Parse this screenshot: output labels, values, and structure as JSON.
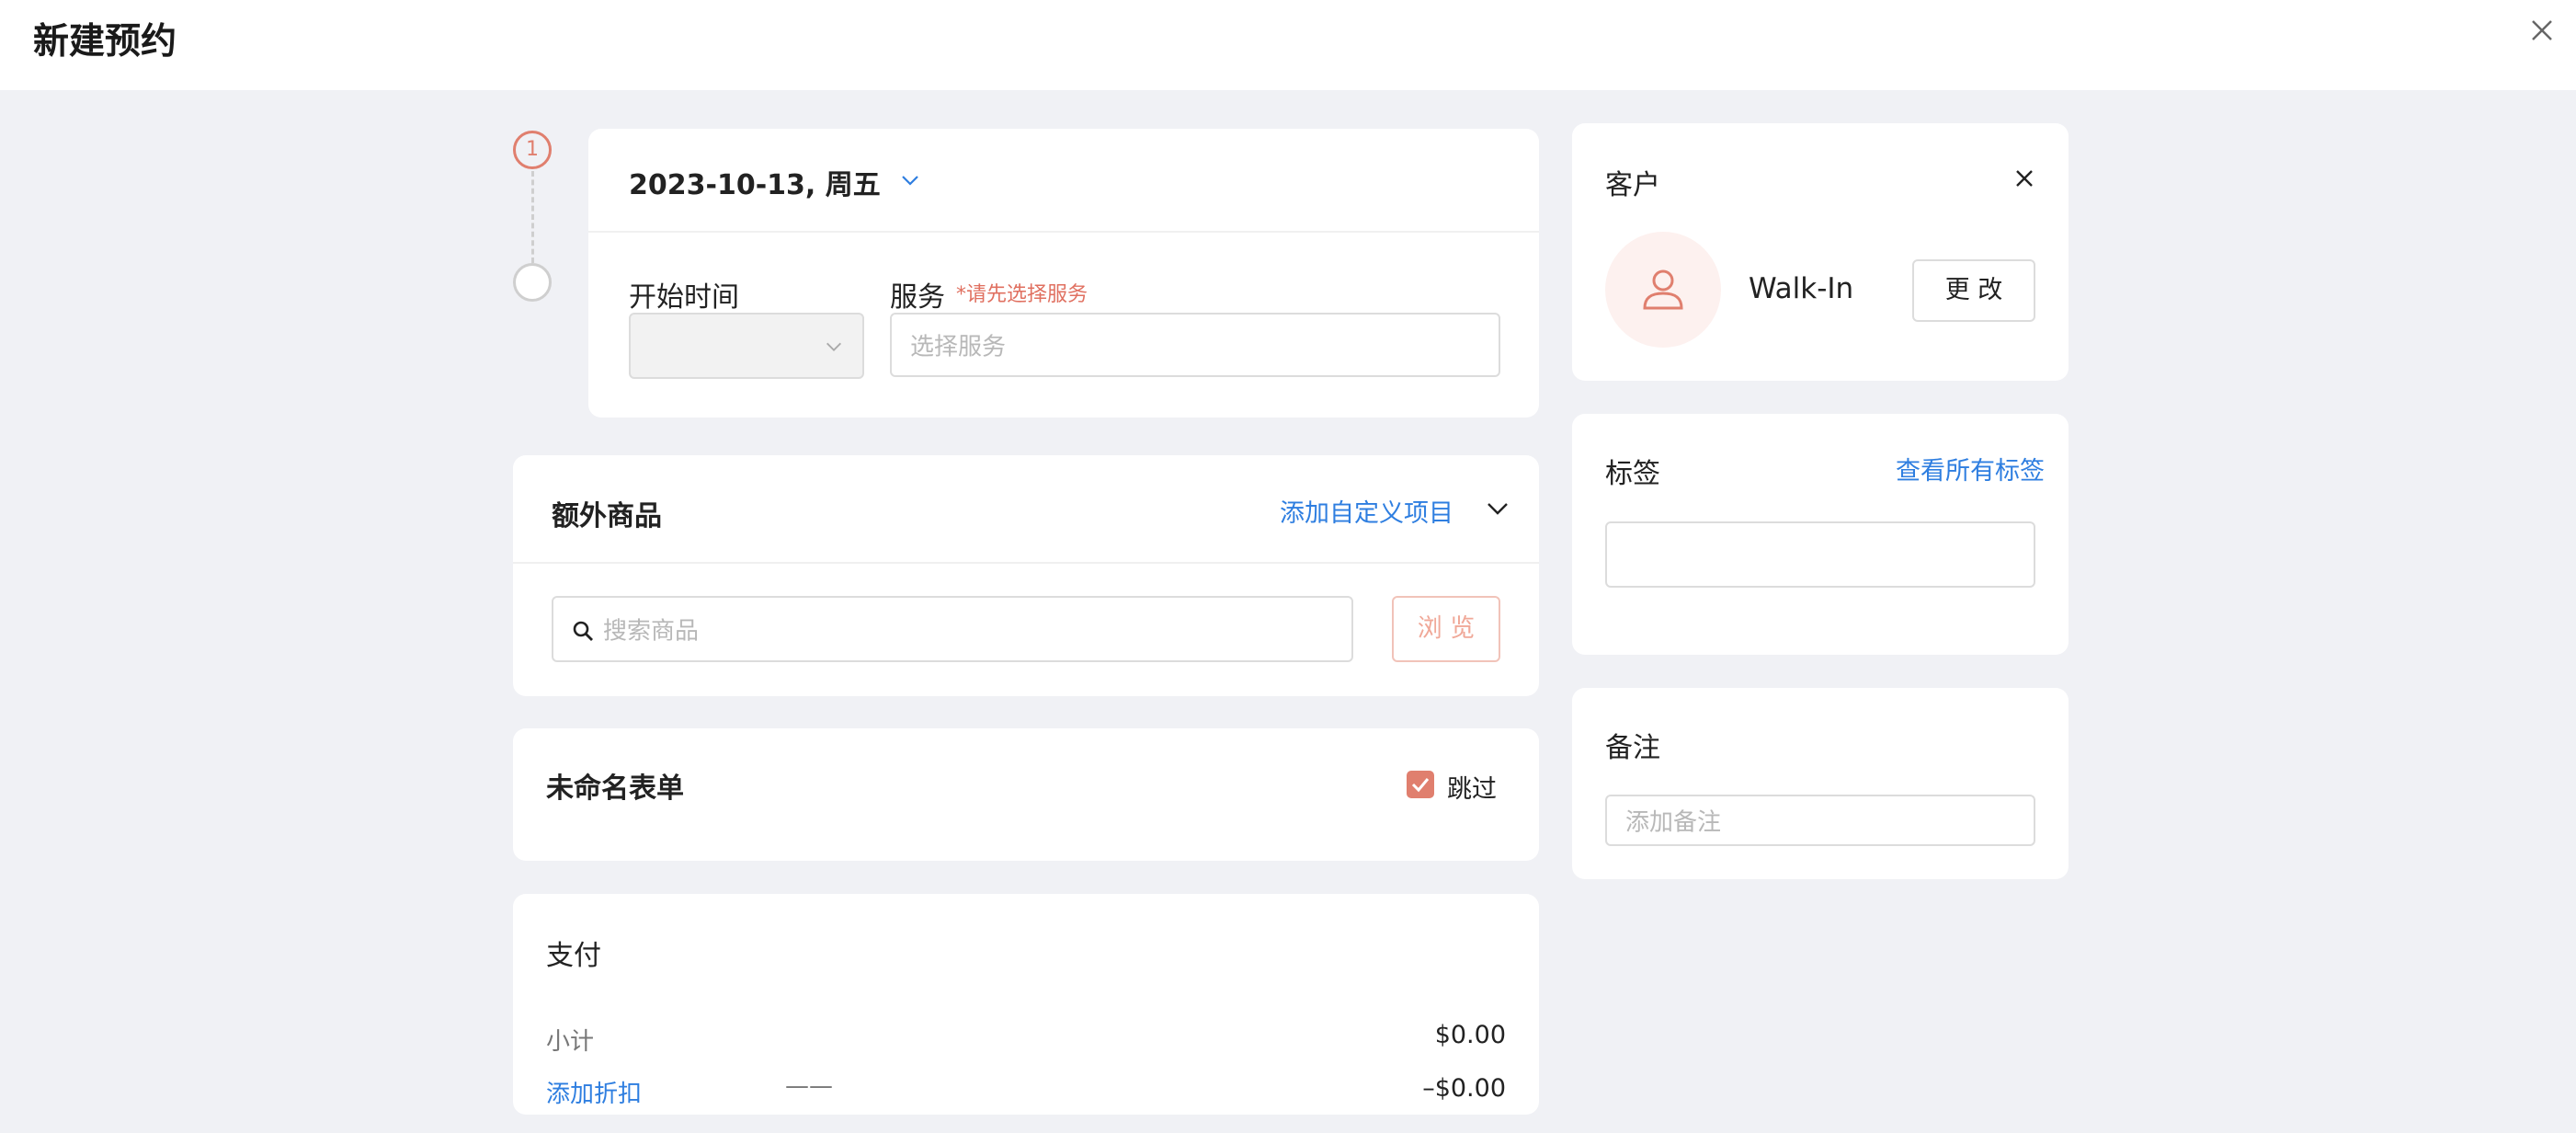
{
  "header": {
    "title": "新建预约"
  },
  "icons": {
    "close": "close-icon",
    "chevron": "chevron-down-icon",
    "search": "search-icon",
    "user": "user-icon",
    "check": "check-icon"
  },
  "colors": {
    "accent": "#e07f6e",
    "link": "#2e7ee0",
    "background": "#f0f1f5"
  },
  "steps": {
    "current": "1"
  },
  "appointment": {
    "date": "2023-10-13, 周五",
    "start_time_label": "开始时间",
    "start_time_value": "",
    "service_label": "服务",
    "service_required_hint": "*请先选择服务",
    "service_placeholder": "选择服务"
  },
  "extras": {
    "title": "额外商品",
    "add_custom_link": "添加自定义项目",
    "search_placeholder": "搜索商品",
    "browse_button": "浏 览"
  },
  "form": {
    "title": "未命名表单",
    "skip_label": "跳过",
    "skip_checked": true
  },
  "payment": {
    "title": "支付",
    "subtotal_label": "小计",
    "subtotal_value": "$0.00",
    "discount_link": "添加折扣",
    "discount_placeholder": "——",
    "discount_value": "–$0.00"
  },
  "customer": {
    "title": "客户",
    "name": "Walk-In",
    "change_button": "更 改"
  },
  "tags": {
    "title": "标签",
    "view_all_link": "查看所有标签"
  },
  "notes": {
    "title": "备注",
    "placeholder": "添加备注"
  }
}
